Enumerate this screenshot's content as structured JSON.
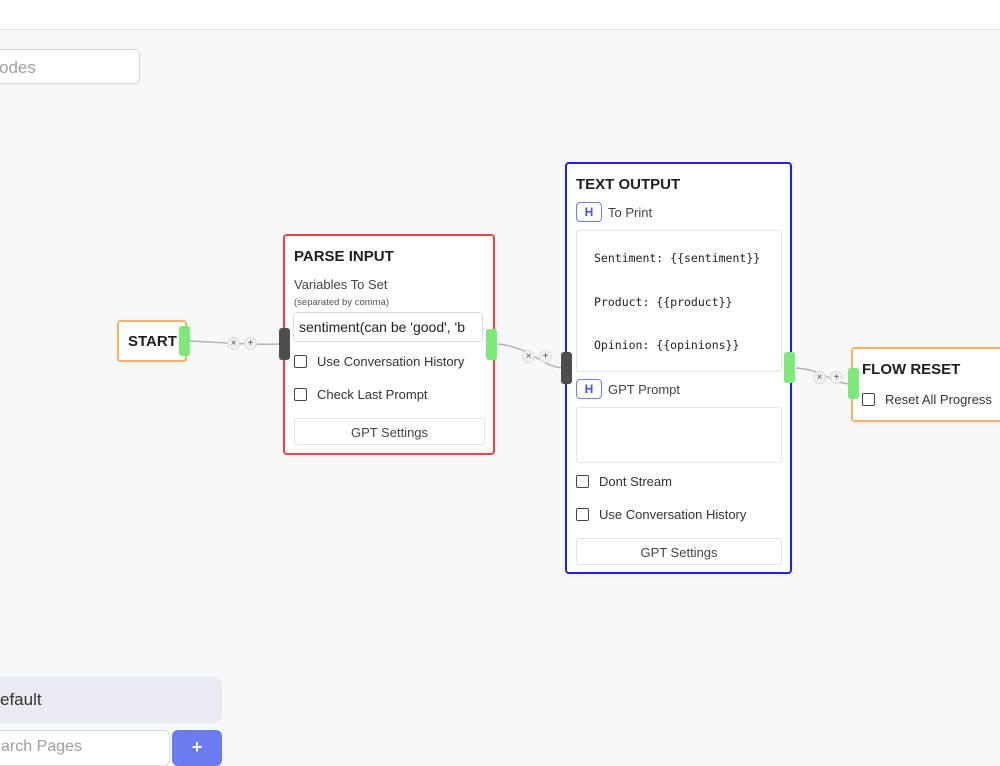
{
  "canvas": {
    "search_nodes_placeholder": "odes"
  },
  "nodes": {
    "start": {
      "title": "START"
    },
    "parse_input": {
      "title": "PARSE INPUT",
      "variables_label": "Variables To Set",
      "variables_hint": "(separated by comma)",
      "variables_value": "sentiment(can be 'good', 'b",
      "use_history_label": "Use Conversation History",
      "check_last_prompt_label": "Check Last Prompt",
      "gpt_settings_label": "GPT Settings"
    },
    "text_output": {
      "title": "TEXT OUTPUT",
      "to_print_badge": "H",
      "to_print_label": "To Print",
      "lines": [
        "Sentiment: {{sentiment}}",
        "Product: {{product}}",
        "Opinion: {{opinions}}"
      ],
      "gpt_prompt_badge": "H",
      "gpt_prompt_label": "GPT Prompt",
      "dont_stream_label": "Dont Stream",
      "use_history_label": "Use Conversation History",
      "gpt_settings_label": "GPT Settings"
    },
    "flow_reset": {
      "title": "FLOW RESET",
      "reset_label": "Reset All Progress"
    }
  },
  "edge_controls": {
    "remove": "×",
    "add": "+"
  },
  "pages": {
    "default_label": "efault",
    "search_placeholder": "arch Pages",
    "add_label": "+"
  },
  "colors": {
    "start_border": "#f7b267",
    "parse_border": "#e8434a",
    "text_output_border": "#2222dd",
    "flow_reset_border": "#f7b267",
    "handle_green": "#7ee87a",
    "handle_dark": "#4d4d4d",
    "accent": "#6b7cf0"
  }
}
